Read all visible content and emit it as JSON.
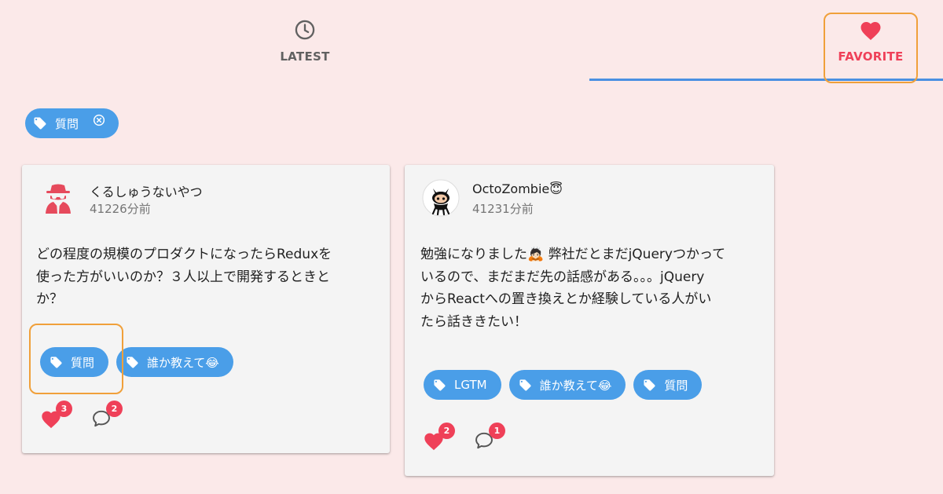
{
  "tabs": [
    {
      "label": "LATEST",
      "icon": "clock-icon"
    },
    {
      "label": "FAVORITE",
      "icon": "heart-icon",
      "active": true
    }
  ],
  "filter": {
    "label": "質問",
    "icon": "tag-icon",
    "clear_icon": "close-circle-icon"
  },
  "posts": [
    {
      "user": "くるしゅうないやつ",
      "time": "41226分前",
      "avatar": "incognito-avatar",
      "body_lines": [
        "どの程度の規模のプロダクトになったらReduxを",
        "使った方がいいのか？３人以上で開発するときと",
        "か？"
      ],
      "tags": [
        "質問",
        "誰か教えて😂"
      ],
      "likes": "3",
      "comments": "2"
    },
    {
      "user": "OctoZombie😇",
      "time": "41231分前",
      "avatar": "octocat-avatar",
      "body_lines": [
        "勉強になりました🙇🏻 弊社だとまだjQueryつかって",
        "いるので、まだまだ先の話感がある。。。jQuery",
        "からReactへの置き換えとか経験している人がい",
        "たら話ききたい！"
      ],
      "tags": [
        "LGTM",
        "誰か教えて😂",
        "質問"
      ],
      "likes": "2",
      "comments": "1"
    }
  ],
  "colors": {
    "background": "#fbe9e9",
    "accent": "#ef4058",
    "chip": "#4a9ee8",
    "indicator": "#4a90e2",
    "highlight": "#f0a03a"
  }
}
